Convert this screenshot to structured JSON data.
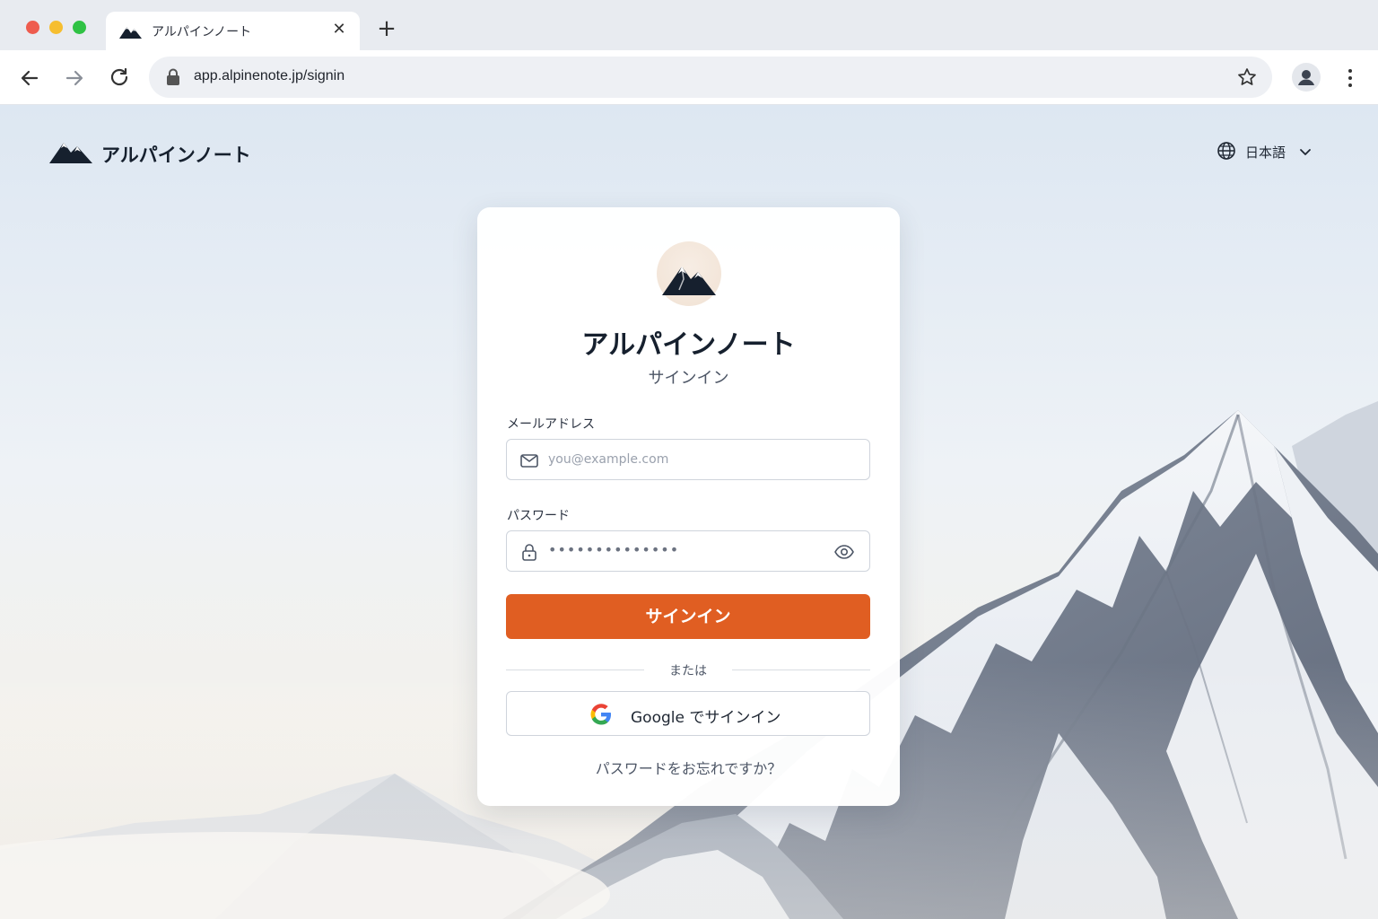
{
  "browser": {
    "tab_title": "アルパインノート",
    "url": "app.alpinenote.jp/signin"
  },
  "header": {
    "brand_name": "アルパインノート",
    "language": "日本語"
  },
  "card": {
    "title": "アルパインノート",
    "subtitle": "サインイン",
    "email_label": "メールアドレス",
    "email_placeholder": "you@example.com",
    "password_label": "パスワード",
    "password_value": "••••••••••••••",
    "signin_button": "サインイン",
    "divider_text": "または",
    "google_button": "Google でサインイン",
    "forgot_link": "パスワードをお忘れですか？"
  },
  "colors": {
    "accent": "#e05e22",
    "brand_dark": "#16202e"
  }
}
